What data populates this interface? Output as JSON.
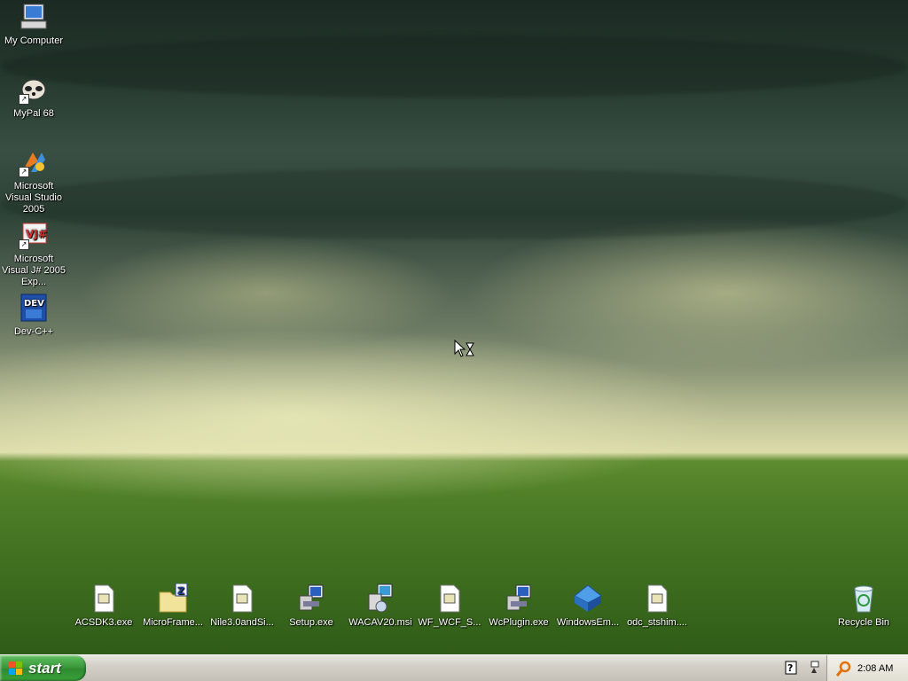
{
  "desktop": {
    "left_icons": [
      {
        "label": "My Computer",
        "icon": "computer-icon"
      },
      {
        "label": "MyPal 68",
        "icon": "raccoon-icon"
      },
      {
        "label": "Microsoft Visual Studio 2005",
        "icon": "visual-studio-icon"
      },
      {
        "label": "Microsoft Visual J# 2005 Exp...",
        "icon": "visual-jsharp-icon"
      },
      {
        "label": "Dev-C++",
        "icon": "devcpp-icon"
      }
    ],
    "bottom_icons": [
      {
        "label": "ACSDK3.exe",
        "icon": "exe-file-icon"
      },
      {
        "label": "MicroFrame...",
        "icon": "zip-folder-icon"
      },
      {
        "label": "Nile3.0andSi...",
        "icon": "exe-file-icon"
      },
      {
        "label": "Setup.exe",
        "icon": "setup-icon"
      },
      {
        "label": "WACAV20.msi",
        "icon": "msi-installer-icon"
      },
      {
        "label": "WF_WCF_S...",
        "icon": "exe-file-icon"
      },
      {
        "label": "WcPlugin.exe",
        "icon": "setup-icon"
      },
      {
        "label": "WindowsEm...",
        "icon": "blue-diamond-icon"
      },
      {
        "label": "odc_stshim....",
        "icon": "exe-file-icon"
      }
    ],
    "recycle_bin": {
      "label": "Recycle Bin",
      "icon": "recycle-bin-icon"
    }
  },
  "taskbar": {
    "start_label": "start",
    "clock": "2:08 AM",
    "tray_icons": [
      "help-icon",
      "network-icon",
      "search-icon"
    ]
  },
  "colors": {
    "start_green": "#3c9a3c",
    "taskbar_gray": "#d4d0c8",
    "grass_green": "#4f7f28"
  }
}
